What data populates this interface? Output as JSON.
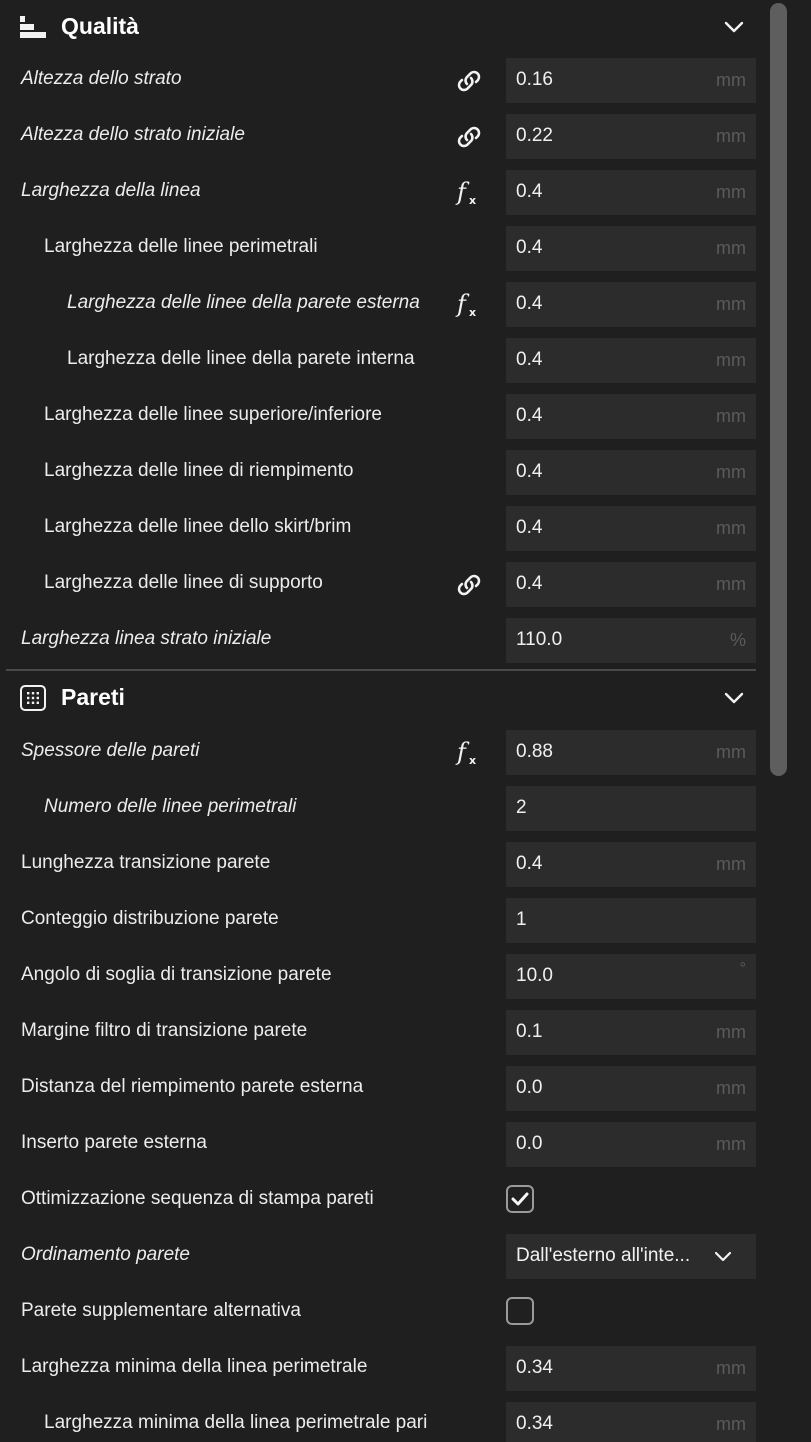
{
  "sections": {
    "quality": {
      "title": "Qualità",
      "icon": "quality-layers-icon"
    },
    "walls": {
      "title": "Pareti",
      "icon": "walls-grid-icon"
    }
  },
  "quality_rows": [
    {
      "label": "Altezza dello strato",
      "value": "0.16",
      "unit": "mm",
      "badge": "link-icon",
      "italic": true
    },
    {
      "label": "Altezza dello strato iniziale",
      "value": "0.22",
      "unit": "mm",
      "badge": "link-icon",
      "italic": true
    },
    {
      "label": "Larghezza della linea",
      "value": "0.4",
      "unit": "mm",
      "badge": "function-icon",
      "italic": true
    },
    {
      "label": "Larghezza delle linee perimetrali",
      "value": "0.4",
      "unit": "mm",
      "badge": "",
      "italic": false
    },
    {
      "label": "Larghezza delle linee della parete esterna",
      "value": "0.4",
      "unit": "mm",
      "badge": "function-icon",
      "italic": true
    },
    {
      "label": "Larghezza delle linee della parete interna",
      "value": "0.4",
      "unit": "mm",
      "badge": "",
      "italic": false
    },
    {
      "label": "Larghezza delle linee superiore/inferiore",
      "value": "0.4",
      "unit": "mm",
      "badge": "",
      "italic": false
    },
    {
      "label": "Larghezza delle linee di riempimento",
      "value": "0.4",
      "unit": "mm",
      "badge": "",
      "italic": false
    },
    {
      "label": "Larghezza delle linee dello skirt/brim",
      "value": "0.4",
      "unit": "mm",
      "badge": "",
      "italic": false
    },
    {
      "label": "Larghezza delle linee di supporto",
      "value": "0.4",
      "unit": "mm",
      "badge": "link-icon",
      "italic": false
    },
    {
      "label": "Larghezza linea strato iniziale",
      "value": "110.0",
      "unit": "%",
      "badge": "",
      "italic": true
    }
  ],
  "wall_rows": [
    {
      "label": "Spessore delle pareti",
      "value": "0.88",
      "unit": "mm",
      "badge": "function-icon",
      "italic": true
    },
    {
      "label": "Numero delle linee perimetrali",
      "value": "2",
      "unit": "",
      "badge": "",
      "italic": true
    },
    {
      "label": "Lunghezza transizione parete",
      "value": "0.4",
      "unit": "mm",
      "badge": "",
      "italic": false
    },
    {
      "label": "Conteggio distribuzione parete",
      "value": "1",
      "unit": "",
      "badge": "",
      "italic": false
    },
    {
      "label": "Angolo di soglia di transizione parete",
      "value": "10.0",
      "unit": "°",
      "badge": "",
      "italic": false
    },
    {
      "label": "Margine filtro di transizione parete",
      "value": "0.1",
      "unit": "mm",
      "badge": "",
      "italic": false
    },
    {
      "label": "Distanza del riempimento parete esterna",
      "value": "0.0",
      "unit": "mm",
      "badge": "",
      "italic": false
    },
    {
      "label": "Inserto parete esterna",
      "value": "0.0",
      "unit": "mm",
      "badge": "",
      "italic": false
    },
    {
      "label": "Ottimizzazione sequenza di stampa pareti",
      "control": "checkbox",
      "checked": true,
      "italic": false
    },
    {
      "label": "Ordinamento parete",
      "control": "select",
      "value": "Dall'esterno all'inte...",
      "italic": true
    },
    {
      "label": "Parete supplementare alternativa",
      "control": "checkbox",
      "checked": false,
      "italic": false
    },
    {
      "label": "Larghezza minima della linea perimetrale",
      "value": "0.34",
      "unit": "mm",
      "badge": "",
      "italic": false
    },
    {
      "label": "Larghezza minima della linea perimetrale pari",
      "value": "0.34",
      "unit": "mm",
      "badge": "",
      "italic": false
    }
  ]
}
